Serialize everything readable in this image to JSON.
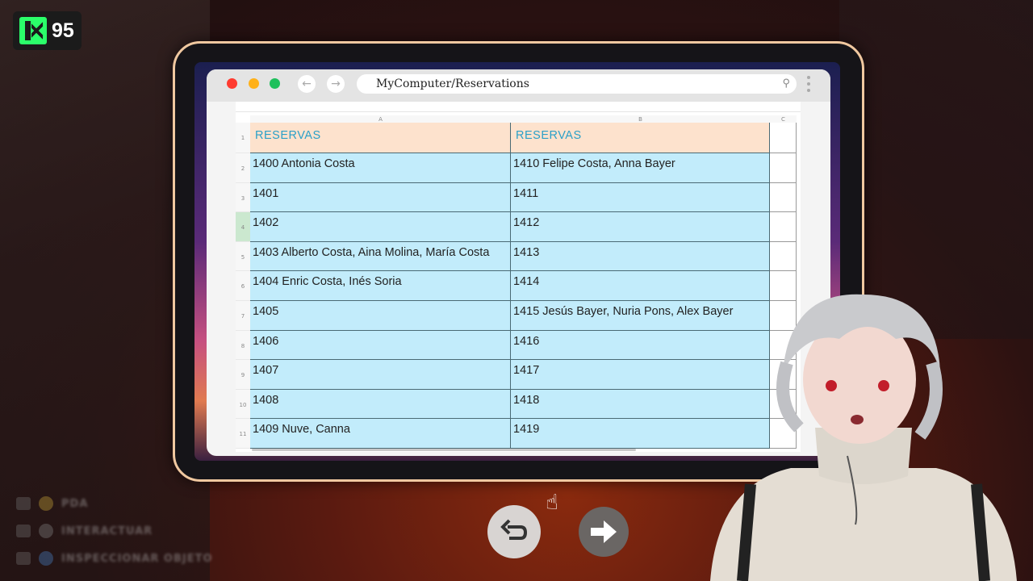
{
  "logo": {
    "number": "95"
  },
  "browser": {
    "url": "MyComputer/Reservations"
  },
  "sheet": {
    "column_headers": [
      "A",
      "B",
      "C"
    ],
    "row_numbers": [
      "1",
      "2",
      "3",
      "4",
      "5",
      "6",
      "7",
      "8",
      "9",
      "10",
      "11"
    ],
    "selected_row": 4,
    "header_row": [
      "RESERVAS",
      "RESERVAS"
    ],
    "rows": [
      [
        "1400  Antonia Costa",
        "1410  Felipe Costa, Anna Bayer"
      ],
      [
        "1401",
        "1411"
      ],
      [
        "1402",
        "1412"
      ],
      [
        "1403  Alberto Costa, Aina Molina, María Costa",
        "1413"
      ],
      [
        "1404  Enric Costa, Inés Soria",
        "1414"
      ],
      [
        "1405",
        "1415  Jesús Bayer, Nuria Pons, Alex Bayer"
      ],
      [
        "1406",
        "1416"
      ],
      [
        "1407",
        "1417"
      ],
      [
        "1408",
        "1418"
      ],
      [
        "1409  Nuve, Canna",
        "1419"
      ]
    ]
  },
  "hints": [
    {
      "label": "PDA",
      "dot_color": "#d8b23a"
    },
    {
      "label": "INTERACTUAR",
      "dot_color": "#8a8a8a"
    },
    {
      "label": "INSPECCIONAR OBJETO",
      "dot_color": "#4a8ad8"
    }
  ],
  "colors": {
    "header_fill": "#fde2cd",
    "header_text": "#2aa0c8",
    "data_fill": "#c2ecfb",
    "logo_accent": "#2bff6a"
  }
}
